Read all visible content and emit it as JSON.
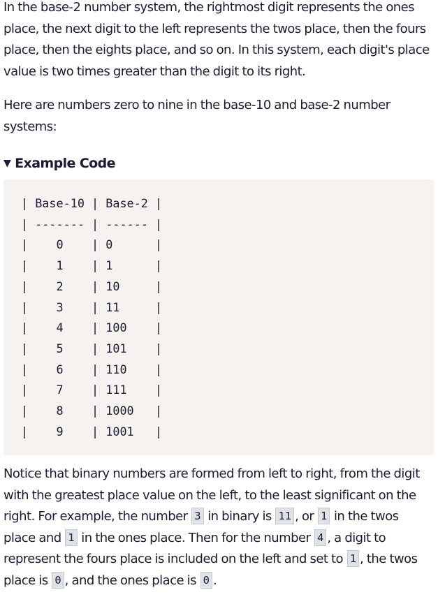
{
  "intro_paragraph": {
    "lines": [
      "In the base-2 number system, the rightmost digit represents the ones",
      "place, the next digit to the left represents the twos place, then the fours",
      "place, then the eights place, and so on. In this system, each digit's place",
      "value is two times greater than the digit to its right."
    ]
  },
  "list_intro": {
    "lines": [
      "Here are numbers zero to nine in the base-10 and base-2 number",
      "systems:"
    ]
  },
  "details": {
    "marker": "▼",
    "summary": "Example Code"
  },
  "code_block": {
    "lines": [
      "| Base-10 | Base-2 |",
      "| ------- | ------ |",
      "|    0    | 0      |",
      "|    1    | 1      |",
      "|    2    | 10     |",
      "|    3    | 11     |",
      "|    4    | 100    |",
      "|    5    | 101    |",
      "|    6    | 110    |",
      "|    7    | 111    |",
      "|    8    | 1000   |",
      "|    9    | 1001   |"
    ]
  },
  "explanation_paragraph": {
    "line1": "Notice that binary numbers are formed from left to right, from the digit",
    "line2": "with the greatest place value on the left, to the least significant on the",
    "line3": {
      "a": "right. For example, the number ",
      "code1": "3",
      "b": " in binary is ",
      "code2": "11",
      "c": ", or ",
      "code3": "1",
      "d": " in the twos"
    },
    "line4": {
      "a": "place and ",
      "code1": "1",
      "b": " in the ones place. Then for the number ",
      "code2": "4",
      "c": ", a digit to"
    },
    "line5": {
      "a": "represent the fours place is included on the left and set to ",
      "code1": "1",
      "b": ", the twos"
    },
    "line6": {
      "a": "place is ",
      "code1": "0",
      "b": ", and the ones place is ",
      "code2": "0",
      "c": "."
    }
  }
}
